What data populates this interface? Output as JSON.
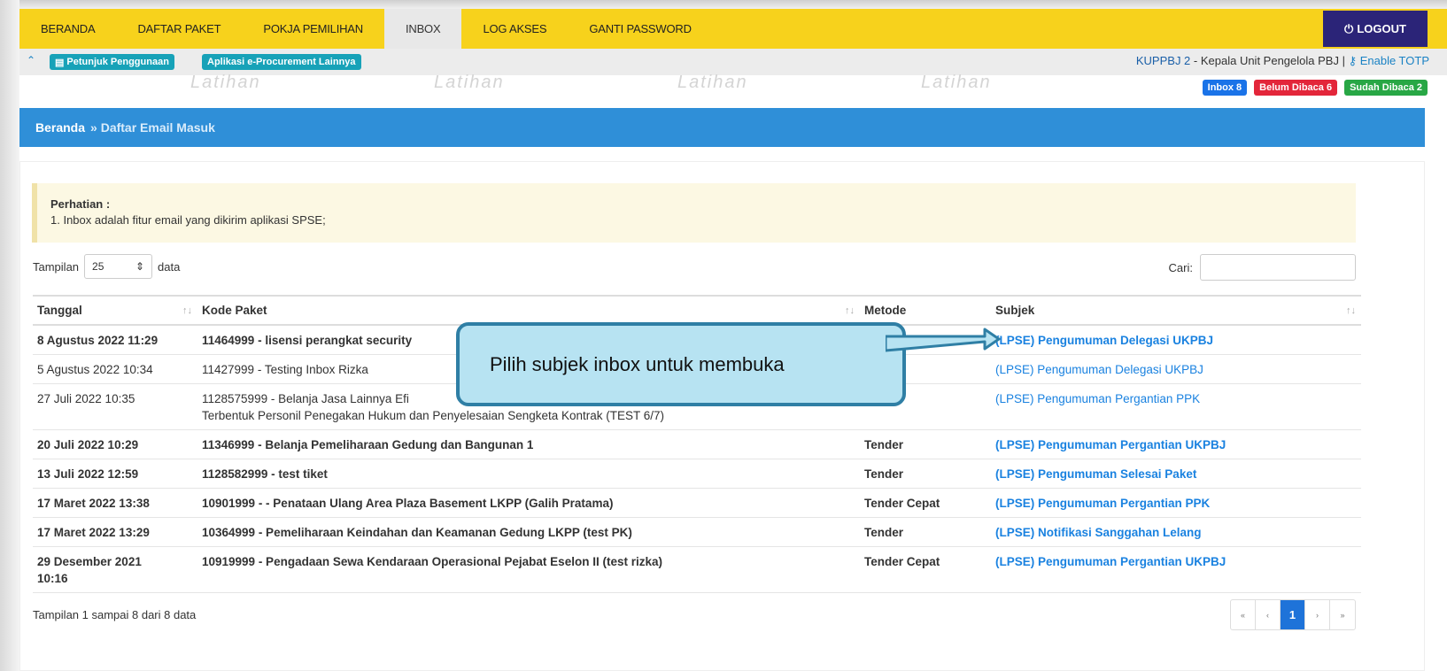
{
  "nav": {
    "items": [
      "BERANDA",
      "DAFTAR PAKET",
      "POKJA PEMILIHAN",
      "INBOX",
      "LOG AKSES",
      "GANTI PASSWORD"
    ],
    "active": "INBOX",
    "logout": "LOGOUT"
  },
  "subbar": {
    "help_label": "Petunjuk Penggunaan",
    "apps_label": "Aplikasi e-Procurement Lainnya",
    "user_name": "KUPPBJ 2",
    "user_role": " - Kepala Unit Pengelola PBJ",
    "separator": " | ",
    "totp_label": "Enable TOTP"
  },
  "watermark": "Latihan",
  "badges": {
    "inbox": "Inbox 8",
    "unread": "Belum Dibaca 6",
    "read": "Sudah Dibaca 2",
    "colors": {
      "inbox": "#1a73e8",
      "unread": "#e3263a",
      "read": "#28a745"
    }
  },
  "breadcrumb": {
    "home": "Beranda",
    "current": "» Daftar Email Masuk"
  },
  "notice": {
    "title": "Perhatian :",
    "text": "1. Inbox adalah fitur email yang dikirim aplikasi SPSE;"
  },
  "length": {
    "prefix": "Tampilan",
    "value": "25",
    "suffix": "data"
  },
  "search": {
    "label": "Cari:",
    "value": ""
  },
  "table": {
    "headers": [
      "Tanggal",
      "Kode Paket",
      "Metode",
      "Subjek"
    ],
    "rows": [
      {
        "date": "8 Agustus 2022 11:29",
        "kode": "11464999 - lisensi perangkat security",
        "metode": "",
        "subjek": "(LPSE) Pengumuman Delegasi UKPBJ",
        "unread": true
      },
      {
        "date": "5 Agustus 2022 10:34",
        "kode": "11427999 - Testing Inbox Rizka",
        "metode": "",
        "subjek": "(LPSE) Pengumuman Delegasi UKPBJ",
        "unread": false
      },
      {
        "date": "27 Juli 2022 10:35",
        "kode": "1128575999 - Belanja Jasa Lainnya Efi",
        "kode2": "Terbentuk Personil Penegakan Hukum dan Penyelesaian Sengketa Kontrak (TEST 6/7)",
        "metode": "",
        "subjek": "(LPSE) Pengumuman Pergantian PPK",
        "unread": false
      },
      {
        "date": "20 Juli 2022 10:29",
        "kode": "11346999 - Belanja Pemeliharaan Gedung dan Bangunan 1",
        "metode": "Tender",
        "subjek": "(LPSE) Pengumuman Pergantian UKPBJ",
        "unread": true
      },
      {
        "date": "13 Juli 2022 12:59",
        "kode": "1128582999 - test tiket",
        "metode": "Tender",
        "subjek": "(LPSE) Pengumuman Selesai Paket",
        "unread": true
      },
      {
        "date": "17 Maret 2022 13:38",
        "kode": "10901999 - - Penataan Ulang Area Plaza Basement LKPP (Galih Pratama)",
        "metode": "Tender Cepat",
        "subjek": "(LPSE) Pengumuman Pergantian PPK",
        "unread": true
      },
      {
        "date": "17 Maret 2022 13:29",
        "kode": "10364999 - Pemeliharaan Keindahan dan Keamanan Gedung LKPP (test PK)",
        "metode": "Tender",
        "subjek": "(LPSE) Notifikasi Sanggahan Lelang",
        "unread": true
      },
      {
        "date": "29 Desember 2021",
        "date2": "10:16",
        "kode": "10919999 - Pengadaan Sewa Kendaraan Operasional Pejabat Eselon II (test rizka)",
        "metode": "Tender Cepat",
        "subjek": "(LPSE) Pengumuman Pergantian UKPBJ",
        "unread": true
      }
    ]
  },
  "footer": {
    "info": "Tampilan 1 sampai 8 dari 8 data"
  },
  "pager": {
    "first": "«",
    "prev": "‹",
    "page": "1",
    "next": "›",
    "last": "»"
  },
  "callout": {
    "text": "Pilih subjek inbox untuk membuka"
  }
}
